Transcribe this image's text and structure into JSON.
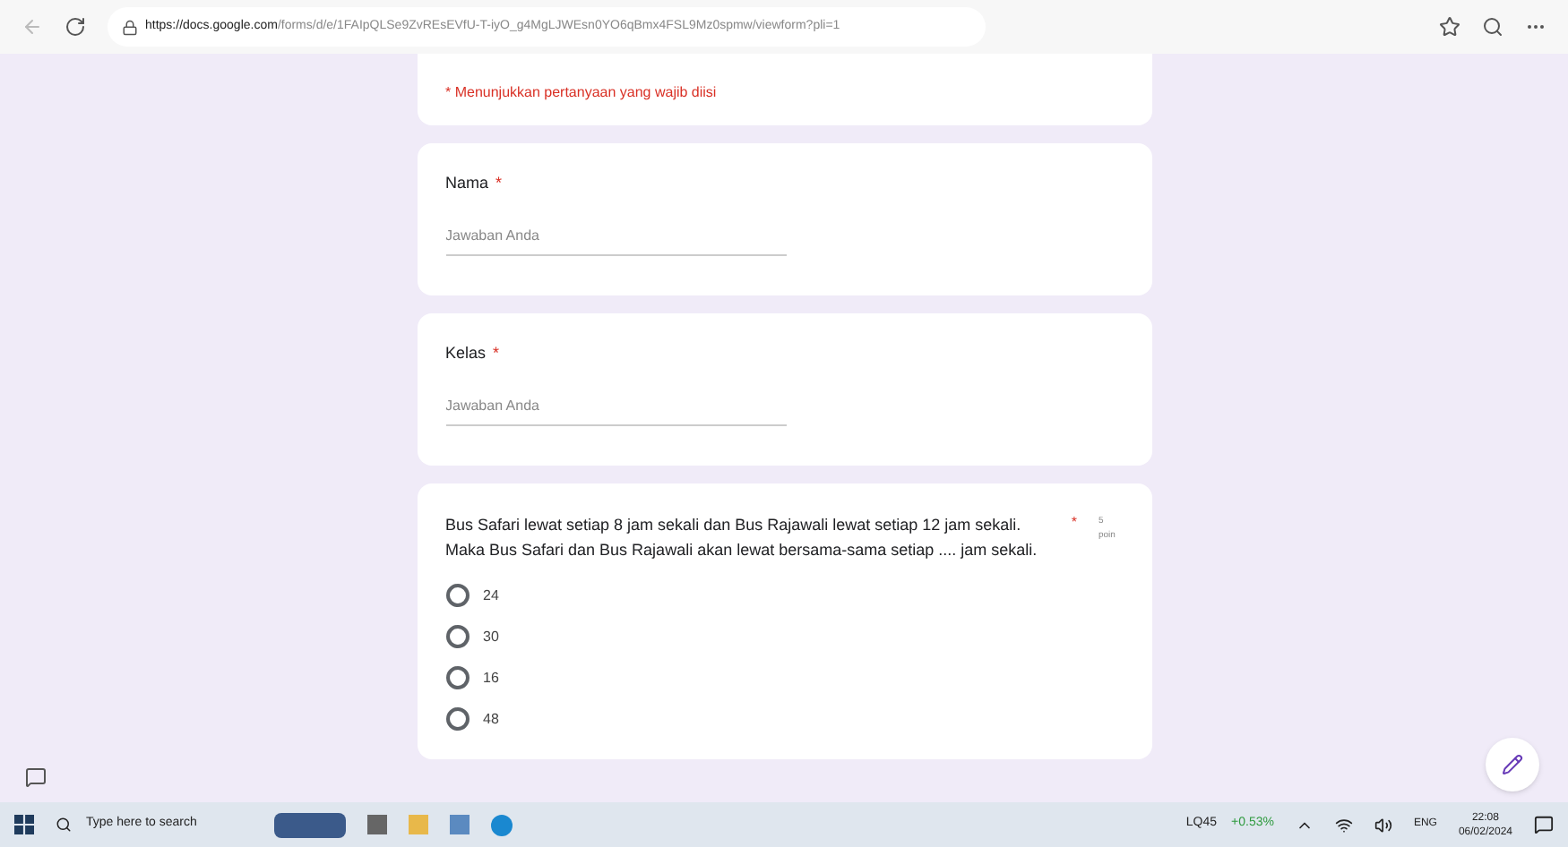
{
  "browser": {
    "url_host": "https://docs.google.com",
    "url_path": "/forms/d/e/1FAIpQLSe9ZvREsEVfU-T-iyO_g4MgLJWEsn0YO6qBmx4FSL9Mz0spmw/viewform?pli=1"
  },
  "form": {
    "required_note": "* Menunjukkan pertanyaan yang wajib diisi",
    "text_questions": [
      {
        "label": "Nama",
        "required_mark": "*",
        "placeholder": "Jawaban Anda"
      },
      {
        "label": "Kelas",
        "required_mark": "*",
        "placeholder": "Jawaban Anda"
      }
    ],
    "choice_question": {
      "text": "Bus Safari lewat setiap 8 jam sekali dan Bus Rajawali lewat setiap 12 jam sekali. Maka Bus Safari dan Bus Rajawali akan lewat bersama-sama setiap .... jam sekali.",
      "required_mark": "*",
      "points": "5 poin",
      "options": [
        {
          "label": "24",
          "selected": false
        },
        {
          "label": "30",
          "selected": false
        },
        {
          "label": "16",
          "selected": false
        },
        {
          "label": "48",
          "selected": false
        }
      ]
    }
  },
  "taskbar": {
    "search_placeholder": "Type here to search",
    "stock": {
      "symbol": "LQ45",
      "change": "+0.53%"
    },
    "language": "ENG",
    "time": "22:08",
    "date": "06/02/2024"
  }
}
